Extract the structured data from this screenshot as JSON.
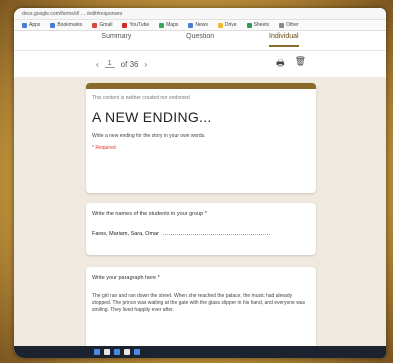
{
  "browser": {
    "url_text": "docs.google.com/forms/d/ … /edit#responses",
    "bookmarks": [
      "Apps",
      "Bookmarks",
      "Gmail",
      "YouTube",
      "Maps",
      "News",
      "Drive",
      "Sheets",
      "Other"
    ]
  },
  "tabs": {
    "summary": "Summary",
    "question": "Question",
    "individual": "Individual"
  },
  "nav": {
    "current": "1",
    "of_total": "of 36",
    "print_icon": "printer-icon",
    "delete_icon": "trash-icon"
  },
  "form": {
    "small_header": "This content is neither created nor endorsed",
    "title": "A NEW ENDING...",
    "description": "Write a new ending for the story in your own words.",
    "required": "* Required"
  },
  "q1": {
    "label": "Write the names of the students in your group *",
    "answer": "Fares, Mariam, Sara, Omar"
  },
  "q2": {
    "label": "Write your paragraph here *",
    "answer": "The girl ran and ran down the street. When she reached the palace, the music had already stopped. The prince was waiting at the gate with the glass slipper in his hand, and everyone was smiling. They lived happily ever after."
  },
  "colors": {
    "accent": "#8a6a2a",
    "frame": "#c99a3e",
    "required": "#dd3333"
  }
}
